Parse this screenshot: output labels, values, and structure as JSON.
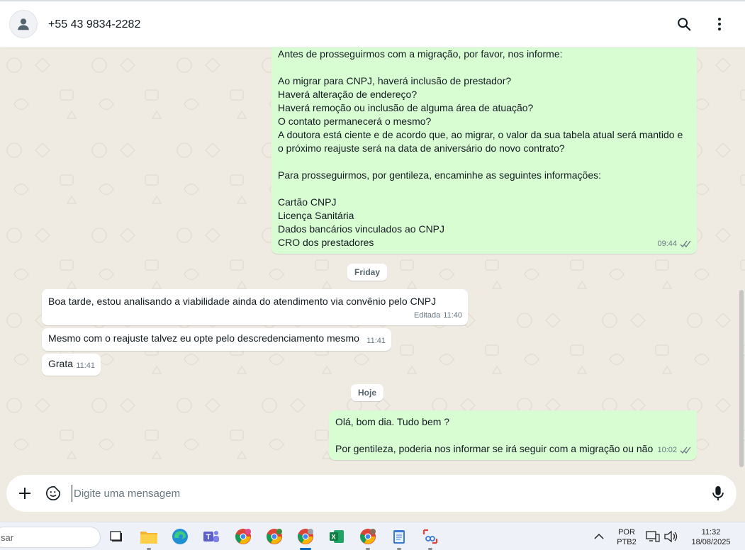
{
  "header": {
    "contact_name": "+55 43 9834-2282"
  },
  "messages": {
    "m1": {
      "lines": [
        "Antes de prosseguirmos com a migração, por favor, nos informe:",
        "",
        "Ao migrar para CNPJ, haverá inclusão de prestador?",
        "Haverá alteração de endereço?",
        "Haverá remoção ou inclusão de alguma área de atuação?",
        "O contato permanecerá o mesmo?",
        "A doutora está ciente e de acordo que, ao migrar, o valor da sua tabela atual será mantido e",
        "o próximo reajuste será na data de aniversário do novo contrato?",
        "",
        "Para prosseguirmos, por gentileza, encaminhe as seguintes informações:",
        "",
        "Cartão CNPJ",
        "Licença Sanitária",
        "Dados bancários vinculados ao CNPJ",
        "CRO dos prestadores"
      ],
      "time": "09:44"
    },
    "day1": "Friday",
    "m2": {
      "text": "Boa tarde, estou analisando a viabilidade ainda do atendimento via convênio pelo CNPJ",
      "edited": "Editada",
      "time": "11:40"
    },
    "m3": {
      "text": "Mesmo com o reajuste talvez eu opte pelo descredenciamento mesmo",
      "time": "11:41"
    },
    "m4": {
      "text": "Grata",
      "time": "11:41"
    },
    "day2": "Hoje",
    "m5": {
      "lines": [
        "Olá, bom dia. Tudo bem ?",
        "",
        "Por gentileza, poderia nos informar se irá seguir com a migração ou não"
      ],
      "time": "10:02"
    }
  },
  "composer": {
    "placeholder": "Digite uma mensagem"
  },
  "taskbar": {
    "search_text": "sar",
    "lang_1": "POR",
    "lang_2": "PTB2",
    "time": "11:32",
    "date": "18/08/2025"
  },
  "colors": {
    "outgoing_bubble": "#d9fdd3",
    "incoming_bubble": "#ffffff",
    "chat_background": "#efeae2",
    "read_ticks": "#667781"
  }
}
